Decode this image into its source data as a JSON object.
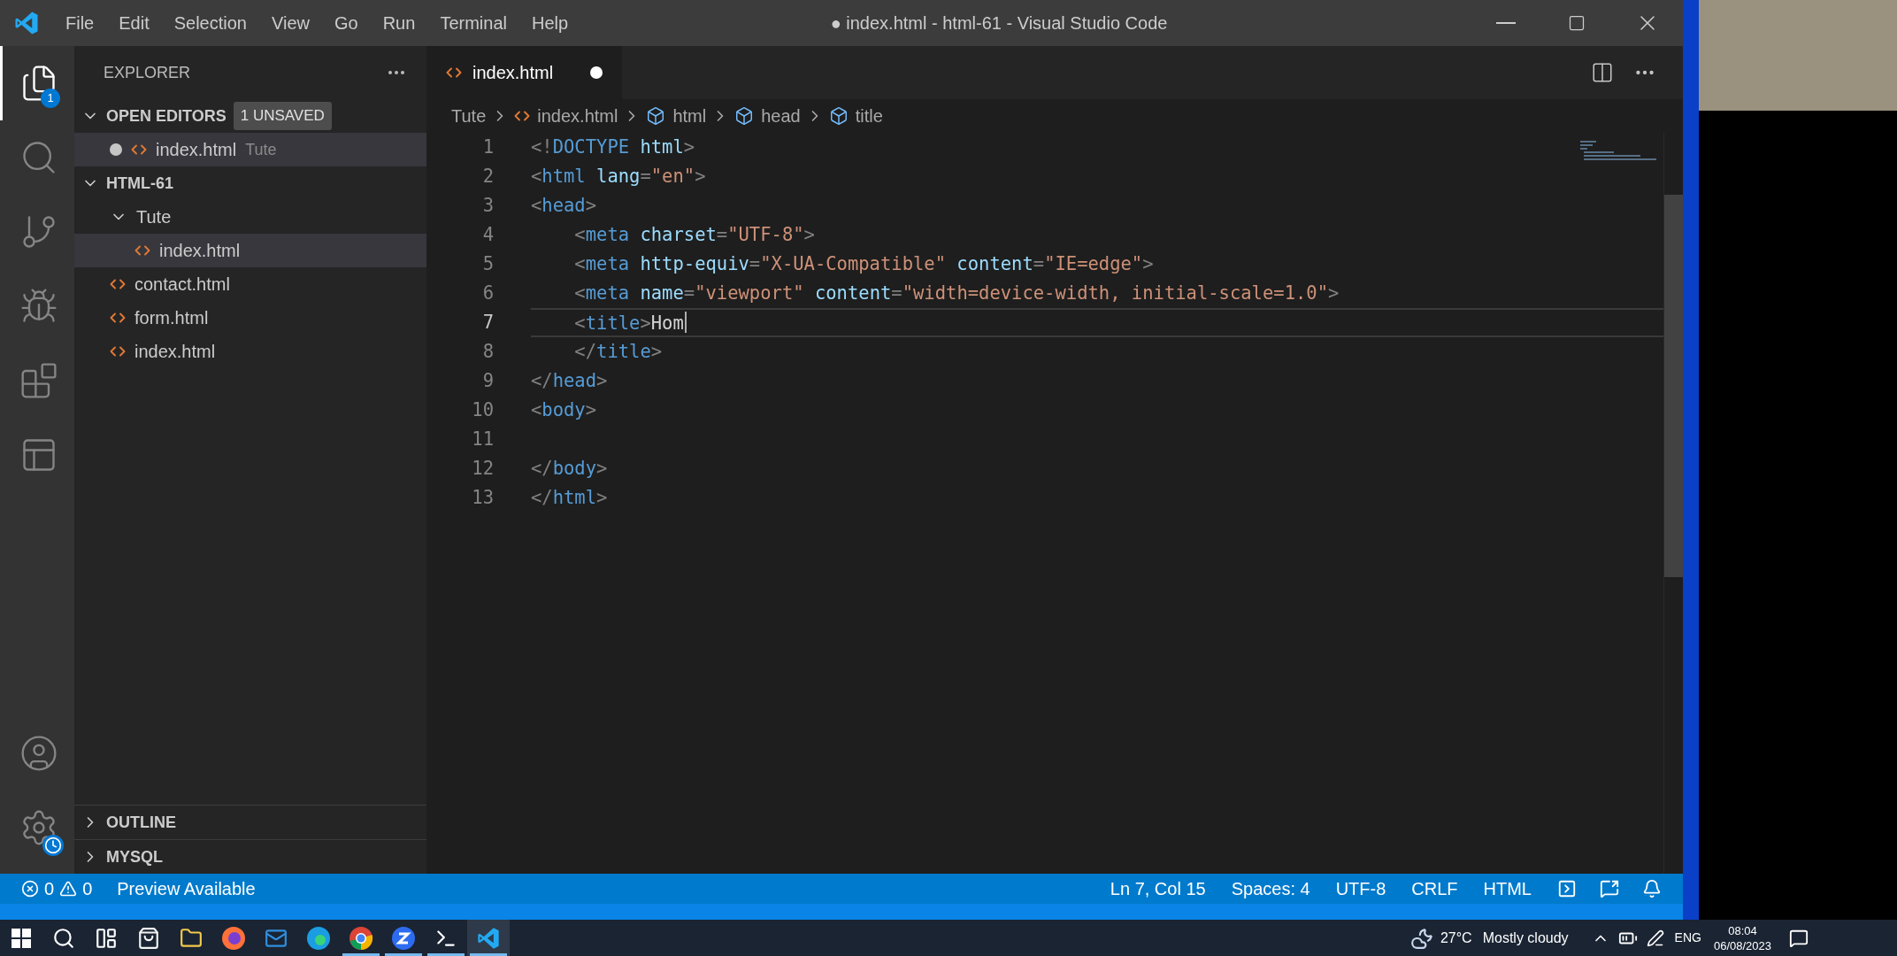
{
  "window": {
    "title": "● index.html - html-61 - Visual Studio Code",
    "menu": [
      "File",
      "Edit",
      "Selection",
      "View",
      "Go",
      "Run",
      "Terminal",
      "Help"
    ]
  },
  "activity_bar": {
    "top": [
      {
        "kind": "explorer",
        "selected": true,
        "badge": "1"
      },
      {
        "kind": "search",
        "selected": false
      },
      {
        "kind": "source-control",
        "selected": false
      },
      {
        "kind": "run-debug",
        "selected": false
      },
      {
        "kind": "extensions",
        "selected": false
      },
      {
        "kind": "browser-panel",
        "selected": false
      }
    ],
    "bottom": [
      {
        "kind": "account"
      },
      {
        "kind": "settings",
        "update_badge": true
      }
    ]
  },
  "sidebar": {
    "title": "EXPLORER",
    "open_editors": {
      "title": "OPEN EDITORS",
      "expanded": true,
      "badge": "1 UNSAVED",
      "items": [
        {
          "name": "index.html",
          "description": "Tute",
          "dirty": true,
          "selected": true
        }
      ]
    },
    "folder": {
      "title": "HTML-61",
      "expanded": true,
      "tree": [
        {
          "name": "Tute",
          "kind": "folder",
          "expanded": true,
          "selected": false,
          "children": [
            {
              "name": "index.html",
              "kind": "file",
              "selected": true
            }
          ]
        },
        {
          "name": "contact.html",
          "kind": "file",
          "selected": false
        },
        {
          "name": "form.html",
          "kind": "file",
          "selected": false
        },
        {
          "name": "index.html",
          "kind": "file",
          "selected": false
        }
      ]
    },
    "collapsed_sections": [
      {
        "title": "OUTLINE",
        "expanded": false
      },
      {
        "title": "MYSQL",
        "expanded": false
      }
    ]
  },
  "tabs": [
    {
      "label": "index.html",
      "dirty": true,
      "selected": true
    }
  ],
  "breadcrumbs": [
    {
      "label": "Tute",
      "kind": "folder"
    },
    {
      "label": "index.html",
      "kind": "file"
    },
    {
      "label": "html",
      "kind": "symbol"
    },
    {
      "label": "head",
      "kind": "symbol"
    },
    {
      "label": "title",
      "kind": "symbol"
    }
  ],
  "editor": {
    "lines": [
      {
        "number": "1",
        "current": false,
        "tokens": [
          {
            "kind": "punct",
            "text": "<!"
          },
          {
            "kind": "tag",
            "text": "DOCTYPE"
          },
          {
            "kind": "attr",
            "text": " html"
          },
          {
            "kind": "punct",
            "text": ">"
          }
        ]
      },
      {
        "number": "2",
        "current": false,
        "tokens": [
          {
            "kind": "punct",
            "text": "<"
          },
          {
            "kind": "tag",
            "text": "html"
          },
          {
            "kind": "attr",
            "text": " lang"
          },
          {
            "kind": "punct",
            "text": "="
          },
          {
            "kind": "string",
            "text": "\"en\""
          },
          {
            "kind": "punct",
            "text": ">"
          }
        ]
      },
      {
        "number": "3",
        "current": false,
        "tokens": [
          {
            "kind": "punct",
            "text": "<"
          },
          {
            "kind": "tag",
            "text": "head"
          },
          {
            "kind": "punct",
            "text": ">"
          }
        ]
      },
      {
        "number": "4",
        "current": false,
        "tokens": [
          {
            "kind": "punct",
            "text": "    <"
          },
          {
            "kind": "tag",
            "text": "meta"
          },
          {
            "kind": "attr",
            "text": " charset"
          },
          {
            "kind": "punct",
            "text": "="
          },
          {
            "kind": "string",
            "text": "\"UTF-8\""
          },
          {
            "kind": "punct",
            "text": ">"
          }
        ]
      },
      {
        "number": "5",
        "current": false,
        "tokens": [
          {
            "kind": "punct",
            "text": "    <"
          },
          {
            "kind": "tag",
            "text": "meta"
          },
          {
            "kind": "attr",
            "text": " http-equiv"
          },
          {
            "kind": "punct",
            "text": "="
          },
          {
            "kind": "string",
            "text": "\"X-UA-Compatible\""
          },
          {
            "kind": "attr",
            "text": " content"
          },
          {
            "kind": "punct",
            "text": "="
          },
          {
            "kind": "string",
            "text": "\"IE=edge\""
          },
          {
            "kind": "punct",
            "text": ">"
          }
        ]
      },
      {
        "number": "6",
        "current": false,
        "tokens": [
          {
            "kind": "punct",
            "text": "    <"
          },
          {
            "kind": "tag",
            "text": "meta"
          },
          {
            "kind": "attr",
            "text": " name"
          },
          {
            "kind": "punct",
            "text": "="
          },
          {
            "kind": "string",
            "text": "\"viewport\""
          },
          {
            "kind": "attr",
            "text": " content"
          },
          {
            "kind": "punct",
            "text": "="
          },
          {
            "kind": "string",
            "text": "\"width=device-width, initial-scale=1.0\""
          },
          {
            "kind": "punct",
            "text": ">"
          }
        ]
      },
      {
        "number": "7",
        "current": true,
        "tokens": [
          {
            "kind": "punct",
            "text": "    <"
          },
          {
            "kind": "tag",
            "text": "title"
          },
          {
            "kind": "punct",
            "text": ">"
          },
          {
            "kind": "text",
            "text": "Hom"
          }
        ]
      },
      {
        "number": "8",
        "current": false,
        "tokens": [
          {
            "kind": "punct",
            "text": "    </"
          },
          {
            "kind": "tag",
            "text": "title"
          },
          {
            "kind": "punct",
            "text": ">"
          }
        ]
      },
      {
        "number": "9",
        "current": false,
        "tokens": [
          {
            "kind": "punct",
            "text": "</"
          },
          {
            "kind": "tag",
            "text": "head"
          },
          {
            "kind": "punct",
            "text": ">"
          }
        ]
      },
      {
        "number": "10",
        "current": false,
        "tokens": [
          {
            "kind": "punct",
            "text": "<"
          },
          {
            "kind": "tag",
            "text": "body"
          },
          {
            "kind": "punct",
            "text": ">"
          }
        ]
      },
      {
        "number": "11",
        "current": false
      },
      {
        "number": "12",
        "current": false,
        "tokens": [
          {
            "kind": "punct",
            "text": "</"
          },
          {
            "kind": "tag",
            "text": "body"
          },
          {
            "kind": "punct",
            "text": ">"
          }
        ]
      },
      {
        "number": "13",
        "current": false,
        "tokens": [
          {
            "kind": "punct",
            "text": "</"
          },
          {
            "kind": "tag",
            "text": "html"
          },
          {
            "kind": "punct",
            "text": ">"
          }
        ]
      }
    ]
  },
  "status_bar": {
    "errors": "0",
    "warnings": "0",
    "left_items": [
      "Preview Available"
    ],
    "right_items": [
      "Ln 7, Col 15",
      "Spaces: 4",
      "UTF-8",
      "CRLF",
      "HTML"
    ]
  },
  "taskbar": {
    "apps": [
      {
        "kind": "start",
        "running": false,
        "selected": false
      },
      {
        "kind": "search",
        "running": false,
        "selected": false
      },
      {
        "kind": "task-view",
        "running": false,
        "selected": false
      },
      {
        "kind": "store",
        "running": false,
        "selected": false
      },
      {
        "kind": "files",
        "running": false,
        "selected": false
      },
      {
        "kind": "firefox",
        "running": false,
        "selected": false
      },
      {
        "kind": "mail",
        "running": false,
        "selected": false
      },
      {
        "kind": "edge",
        "running": false,
        "selected": false
      },
      {
        "kind": "chrome",
        "running": true,
        "selected": false
      },
      {
        "kind": "zoom",
        "running": true,
        "selected": false
      },
      {
        "kind": "terminal",
        "running": true,
        "selected": false
      },
      {
        "kind": "vscode",
        "running": true,
        "selected": true
      }
    ],
    "weather": {
      "temperature": "27°C",
      "condition": "Mostly cloudy"
    },
    "language": "ENG",
    "time": "08:04",
    "date": "06/08/2023"
  }
}
